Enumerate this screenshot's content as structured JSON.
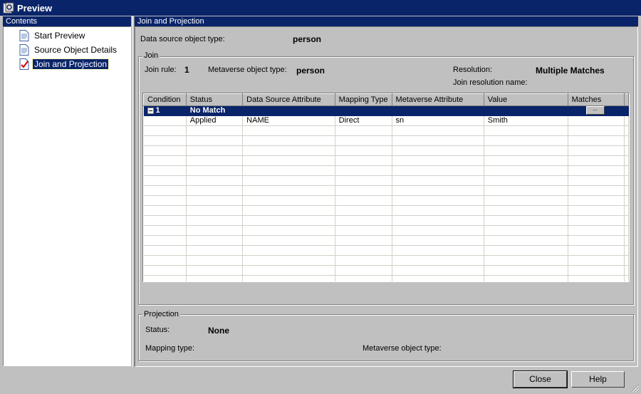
{
  "window": {
    "title": "Preview"
  },
  "contents": {
    "header": "Contents",
    "items": [
      {
        "label": "Start Preview",
        "icon": "document-icon"
      },
      {
        "label": "Source Object Details",
        "icon": "document-icon"
      },
      {
        "label": "Join and Projection",
        "icon": "document-check-icon",
        "selected": true
      }
    ]
  },
  "main": {
    "header": "Join and Projection",
    "data_source": {
      "label": "Data source object type:",
      "value": "person"
    },
    "join": {
      "legend": "Join",
      "join_rule_label": "Join rule:",
      "join_rule_value": "1",
      "mv_type_label": "Metaverse object type:",
      "mv_type_value": "person",
      "resolution_label": "Resolution:",
      "resolution_value": "Multiple Matches",
      "resolution_name_label": "Join resolution name:",
      "table": {
        "columns": [
          "Condition",
          "Status",
          "Data Source Attribute",
          "Mapping Type",
          "Metaverse Attribute",
          "Value",
          "Matches"
        ],
        "rows": [
          {
            "condition": "1",
            "status": "No Match",
            "ds_attr": "",
            "mapping": "",
            "mv_attr": "",
            "value": "",
            "matches_button": "..."
          },
          {
            "condition": "",
            "status": "Applied",
            "ds_attr": "NAME",
            "mapping": "Direct",
            "mv_attr": "sn",
            "value": "Smith",
            "matches_button": ""
          }
        ]
      }
    },
    "projection": {
      "legend": "Projection",
      "status_label": "Status:",
      "status_value": "None",
      "mapping_label": "Mapping type:",
      "mv_type_label": "Metaverse object type:"
    }
  },
  "buttons": {
    "close": "Close",
    "help": "Help"
  }
}
